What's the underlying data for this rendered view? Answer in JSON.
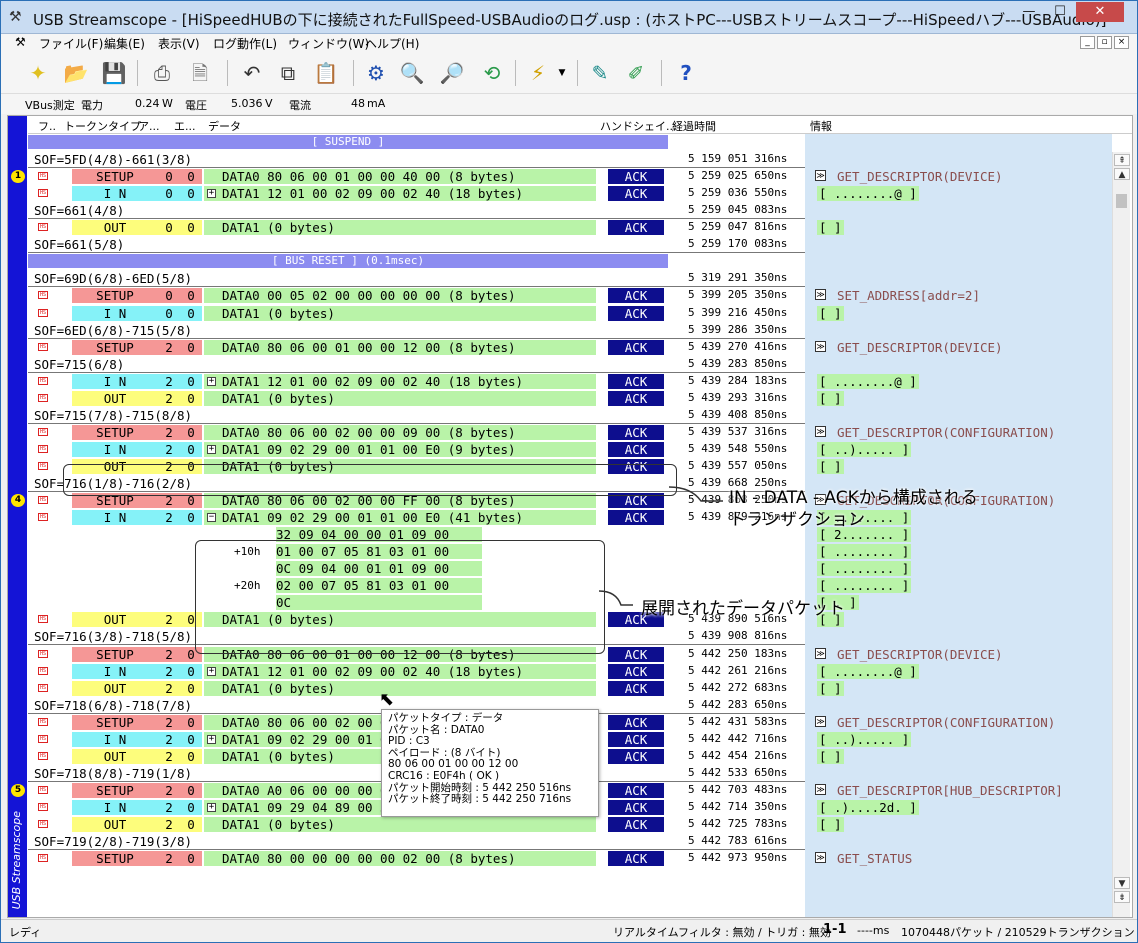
{
  "window": {
    "title": "USB Streamscope - [HiSpeedHUBの下に接続されたFullSpeed-USBAudioのログ.usp : (ホストPC---USBストリームスコープ---HiSpeedハブ---USBAudio)]",
    "min": "—",
    "max": "☐",
    "close": "✕"
  },
  "menu": [
    "ファイル(F)",
    "編集(E)",
    "表示(V)",
    "ログ動作(L)",
    "ウィンドウ(W)",
    "ヘルプ(H)"
  ],
  "mdi": [
    "_",
    "▫",
    "×"
  ],
  "toolbar": [
    "new-file-icon",
    "open-folder-icon",
    "save-icon",
    "print-icon",
    "print-preview-icon",
    "undo-icon",
    "copy-icon",
    "paste-icon",
    "settings-icon",
    "search-icon",
    "zoom-icon",
    "jump-icon",
    "trigger-icon",
    "marker-icon",
    "marker-clear-icon",
    "help-icon"
  ],
  "vbus": {
    "label": "VBus測定",
    "power_label": "電力",
    "power_value": "0.24",
    "power_unit": "W",
    "voltage_label": "電圧",
    "voltage_value": "5.036",
    "voltage_unit": "V",
    "current_label": "電流",
    "current_value": "48",
    "current_unit": "mA"
  },
  "columns": {
    "f": "フ..",
    "token": "トークンタイプ",
    "addr": "ア...",
    "ep": "エ...",
    "data": "データ",
    "hs": "ハンドシェイ...",
    "time": "経過時間",
    "info": "情報"
  },
  "side_label": "USB Streamscope",
  "markers": [
    "1",
    "4",
    "5"
  ],
  "rows": [
    {
      "kind": "banner",
      "text": "[ SUSPEND ]"
    },
    {
      "kind": "sof",
      "text": "SOF=5FD(4/8)-661(3/8)",
      "time": "5 159 051 316ns"
    },
    {
      "kind": "tx",
      "type": "SETUP",
      "addr": "0",
      "ep": "0",
      "data": "DATA0 80 06 00 01 00 00 40 00 (8 bytes)",
      "hs": "ACK",
      "time": "5 259 025 650ns"
    },
    {
      "kind": "tx",
      "type": "I N",
      "addr": "0",
      "ep": "0",
      "exp": "+",
      "data": "DATA1 12 01 00 02 09 00 02 40 (18 bytes)",
      "hs": "ACK",
      "time": "5 259 036 550ns"
    },
    {
      "kind": "sof",
      "text": "SOF=661(4/8)",
      "time": "5 259 045 083ns"
    },
    {
      "kind": "tx",
      "type": "OUT",
      "addr": "0",
      "ep": "0",
      "data": "DATA1                        (0 bytes)",
      "hs": "ACK",
      "time": "5 259 047 816ns"
    },
    {
      "kind": "sof",
      "text": "SOF=661(5/8)",
      "time": "5 259 170 083ns"
    },
    {
      "kind": "banner",
      "text": "[ BUS RESET ] (0.1msec)"
    },
    {
      "kind": "sof",
      "text": "SOF=69D(6/8)-6ED(5/8)",
      "time": "5 319 291 350ns"
    },
    {
      "kind": "tx",
      "type": "SETUP",
      "addr": "0",
      "ep": "0",
      "data": "DATA0 00 05 02 00 00 00 00 00 (8 bytes)",
      "hs": "ACK",
      "time": "5 399 205 350ns"
    },
    {
      "kind": "tx",
      "type": "I N",
      "addr": "0",
      "ep": "0",
      "data": "DATA1                        (0 bytes)",
      "hs": "ACK",
      "time": "5 399 216 450ns"
    },
    {
      "kind": "sof",
      "text": "SOF=6ED(6/8)-715(5/8)",
      "time": "5 399 286 350ns"
    },
    {
      "kind": "tx",
      "type": "SETUP",
      "addr": "2",
      "ep": "0",
      "data": "DATA0 80 06 00 01 00 00 12 00 (8 bytes)",
      "hs": "ACK",
      "time": "5 439 270 416ns"
    },
    {
      "kind": "sof",
      "text": "SOF=715(6/8)",
      "time": "5 439 283 850ns"
    },
    {
      "kind": "tx",
      "type": "I N",
      "addr": "2",
      "ep": "0",
      "exp": "+",
      "data": "DATA1 12 01 00 02 09 00 02 40 (18 bytes)",
      "hs": "ACK",
      "time": "5 439 284 183ns"
    },
    {
      "kind": "tx",
      "type": "OUT",
      "addr": "2",
      "ep": "0",
      "data": "DATA1                        (0 bytes)",
      "hs": "ACK",
      "time": "5 439 293 316ns"
    },
    {
      "kind": "sof",
      "text": "SOF=715(7/8)-715(8/8)",
      "time": "5 439 408 850ns"
    },
    {
      "kind": "tx",
      "type": "SETUP",
      "addr": "2",
      "ep": "0",
      "data": "DATA0 80 06 00 02 00 00 09 00 (8 bytes)",
      "hs": "ACK",
      "time": "5 439 537 316ns"
    },
    {
      "kind": "tx",
      "type": "I N",
      "addr": "2",
      "ep": "0",
      "exp": "+",
      "data": "DATA1 09 02 29 00 01 01 00 E0 (9 bytes)",
      "hs": "ACK",
      "time": "5 439 548 550ns"
    },
    {
      "kind": "tx",
      "type": "OUT",
      "addr": "2",
      "ep": "0",
      "data": "DATA1                        (0 bytes)",
      "hs": "ACK",
      "time": "5 439 557 050ns"
    },
    {
      "kind": "sof",
      "text": "SOF=716(1/8)-716(2/8)",
      "time": "5 439 668 250ns"
    },
    {
      "kind": "tx",
      "type": "SETUP",
      "addr": "2",
      "ep": "0",
      "data": "DATA0 80 06 00 02 00 00 FF 00 (8 bytes)",
      "hs": "ACK",
      "time": "5 439 868 250ns"
    },
    {
      "kind": "tx",
      "type": "I N",
      "addr": "2",
      "ep": "0",
      "exp": "−",
      "data": "DATA1 09 02 29 00 01 01 00 E0 (41 bytes)",
      "hs": "ACK",
      "time": "5 439 879 216ns"
    },
    {
      "kind": "cont",
      "off": "",
      "data": "32 09 04 00 00 01 09 00"
    },
    {
      "kind": "cont",
      "off": "+10h",
      "data": "01 00 07 05 81 03 01 00"
    },
    {
      "kind": "cont",
      "off": "",
      "data": "0C 09 04 00 01 01 09 00"
    },
    {
      "kind": "cont",
      "off": "+20h",
      "data": "02 00 07 05 81 03 01 00"
    },
    {
      "kind": "cont",
      "off": "",
      "data": "0C"
    },
    {
      "kind": "tx",
      "type": "OUT",
      "addr": "2",
      "ep": "0",
      "data": "DATA1                        (0 bytes)",
      "hs": "ACK",
      "time": "5 439 890 516ns"
    },
    {
      "kind": "sof",
      "text": "SOF=716(3/8)-718(5/8)",
      "time": "5 439 908 816ns"
    },
    {
      "kind": "tx",
      "type": "SETUP",
      "addr": "2",
      "ep": "0",
      "data": "DATA0 80 06 00 01 00 00 12 00 (8 bytes)",
      "hs": "ACK",
      "time": "5 442 250 183ns"
    },
    {
      "kind": "tx",
      "type": "I N",
      "addr": "2",
      "ep": "0",
      "exp": "+",
      "data": "DATA1 12 01 00 02 09 00 02 40 (18 bytes)",
      "hs": "ACK",
      "time": "5 442 261 216ns"
    },
    {
      "kind": "tx",
      "type": "OUT",
      "addr": "2",
      "ep": "0",
      "data": "DATA1                        (0 bytes)",
      "hs": "ACK",
      "time": "5 442 272 683ns"
    },
    {
      "kind": "sof",
      "text": "SOF=718(6/8)-718(7/8)",
      "time": "5 442 283 650ns"
    },
    {
      "kind": "tx",
      "type": "SETUP",
      "addr": "2",
      "ep": "0",
      "data": "DATA0 80 06 00 02 00 00 09 00 (8 bytes)",
      "hs": "ACK",
      "time": "5 442 431 583ns"
    },
    {
      "kind": "tx",
      "type": "I N",
      "addr": "2",
      "ep": "0",
      "exp": "+",
      "data": "DATA1 09 02 29 00 01 01 00 E0 (9 bytes)",
      "hs": "ACK",
      "time": "5 442 442 716ns"
    },
    {
      "kind": "tx",
      "type": "OUT",
      "addr": "2",
      "ep": "0",
      "data": "DATA1                        (0 bytes)",
      "hs": "ACK",
      "time": "5 442 454 216ns"
    },
    {
      "kind": "sof",
      "text": "SOF=718(8/8)-719(1/8)",
      "time": "5 442 533 650ns"
    },
    {
      "kind": "tx",
      "type": "SETUP",
      "addr": "2",
      "ep": "0",
      "data": "DATA0 A0 06 00 00 00 00 47 00 (8 bytes)",
      "hs": "ACK",
      "time": "5 442 703 483ns"
    },
    {
      "kind": "tx",
      "type": "I N",
      "addr": "2",
      "ep": "0",
      "exp": "+",
      "data": "DATA1 09 29 04 89 00 32 64 00 (9 bytes)",
      "hs": "ACK",
      "time": "5 442 714 350ns"
    },
    {
      "kind": "tx",
      "type": "OUT",
      "addr": "2",
      "ep": "0",
      "data": "DATA1                        (0 bytes)",
      "hs": "ACK",
      "time": "5 442 725 783ns"
    },
    {
      "kind": "sof",
      "text": "SOF=719(2/8)-719(3/8)",
      "time": "5 442 783 616ns"
    },
    {
      "kind": "tx",
      "type": "SETUP",
      "addr": "2",
      "ep": "0",
      "data": "DATA0 80 00 00 00 00 00 02 00 (8 bytes)",
      "hs": "ACK",
      "time": "5 442 973 950ns"
    }
  ],
  "info": [
    {
      "row": 2,
      "kind": "desc",
      "text": "GET_DESCRIPTOR(DEVICE)"
    },
    {
      "row": 3,
      "kind": "val",
      "text": "[ ........@ ]"
    },
    {
      "row": 5,
      "kind": "val",
      "text": "[  ]"
    },
    {
      "row": 9,
      "kind": "desc",
      "text": "SET_ADDRESS[addr=2]"
    },
    {
      "row": 10,
      "kind": "val",
      "text": "[  ]"
    },
    {
      "row": 12,
      "kind": "desc",
      "text": "GET_DESCRIPTOR(DEVICE)"
    },
    {
      "row": 14,
      "kind": "val",
      "text": "[ ........@ ]"
    },
    {
      "row": 15,
      "kind": "val",
      "text": "[  ]"
    },
    {
      "row": 17,
      "kind": "desc",
      "text": "GET_DESCRIPTOR(CONFIGURATION)"
    },
    {
      "row": 18,
      "kind": "val",
      "text": "[ ..)..... ]"
    },
    {
      "row": 19,
      "kind": "val",
      "text": "[  ]"
    },
    {
      "row": 21,
      "kind": "desc",
      "text": "GET_DESCRIPTOR(CONFIGURATION)"
    },
    {
      "row": 22,
      "kind": "val",
      "text": "[ ..)..... ]"
    },
    {
      "row": 23,
      "kind": "val",
      "text": "[ 2....... ]"
    },
    {
      "row": 24,
      "kind": "val",
      "text": "[ ........ ]"
    },
    {
      "row": 25,
      "kind": "val",
      "text": "[ ........ ]"
    },
    {
      "row": 26,
      "kind": "val",
      "text": "[ ........ ]"
    },
    {
      "row": 27,
      "kind": "val",
      "text": "[ . ]"
    },
    {
      "row": 28,
      "kind": "val",
      "text": "[  ]"
    },
    {
      "row": 30,
      "kind": "desc",
      "text": "GET_DESCRIPTOR(DEVICE)"
    },
    {
      "row": 31,
      "kind": "val",
      "text": "[ ........@ ]"
    },
    {
      "row": 32,
      "kind": "val",
      "text": "[  ]"
    },
    {
      "row": 34,
      "kind": "desc",
      "text": "GET_DESCRIPTOR(CONFIGURATION)"
    },
    {
      "row": 35,
      "kind": "val",
      "text": "[ ..)..... ]"
    },
    {
      "row": 36,
      "kind": "val",
      "text": "[  ]"
    },
    {
      "row": 38,
      "kind": "desc",
      "text": "GET_DESCRIPTOR[HUB_DESCRIPTOR]"
    },
    {
      "row": 39,
      "kind": "val",
      "text": "[ .)....2d. ]"
    },
    {
      "row": 40,
      "kind": "val",
      "text": "[  ]"
    },
    {
      "row": 42,
      "kind": "desc",
      "text": "GET_STATUS"
    }
  ],
  "annotations": {
    "transaction": "IN - DATA - ACKから構成される\nトランザクション",
    "expanded": "展開されたデータパケット"
  },
  "tooltip": [
    "パケットタイプ : データ",
    "パケット名   : DATA0",
    "PID      : C3",
    "ペイロード   : (8 バイト)",
    "     80 06 00 01 00 00 12 00",
    "CRC16     : E0F4h ( OK )",
    "パケット開始時刻 : 5 442 250 516ns",
    "パケット終了時刻 : 5 442 250 716ns"
  ],
  "status": {
    "left": "レディ",
    "filter": "リアルタイムフィルタ : 無効 / トリガ : 無効",
    "range": "1-1",
    "ms": "----ms",
    "counts": "1070448パケット / 210529トランザクション"
  }
}
